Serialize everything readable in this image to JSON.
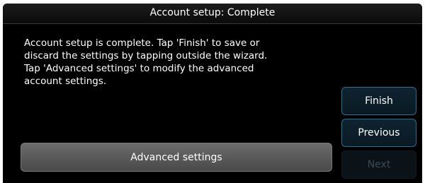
{
  "dialog": {
    "title": "Account setup: Complete",
    "message": "Account setup is complete. Tap 'Finish' to save or discard the settings by tapping outside the wizard. Tap 'Advanced settings' to modify the advanced account settings."
  },
  "buttons": {
    "advanced_label": "Advanced settings",
    "finish_label": "Finish",
    "previous_label": "Previous",
    "next_label": "Next"
  },
  "colors": {
    "background": "#000000",
    "button_border_active": "#2c6f8f",
    "button_text_disabled": "#3e4a53"
  }
}
